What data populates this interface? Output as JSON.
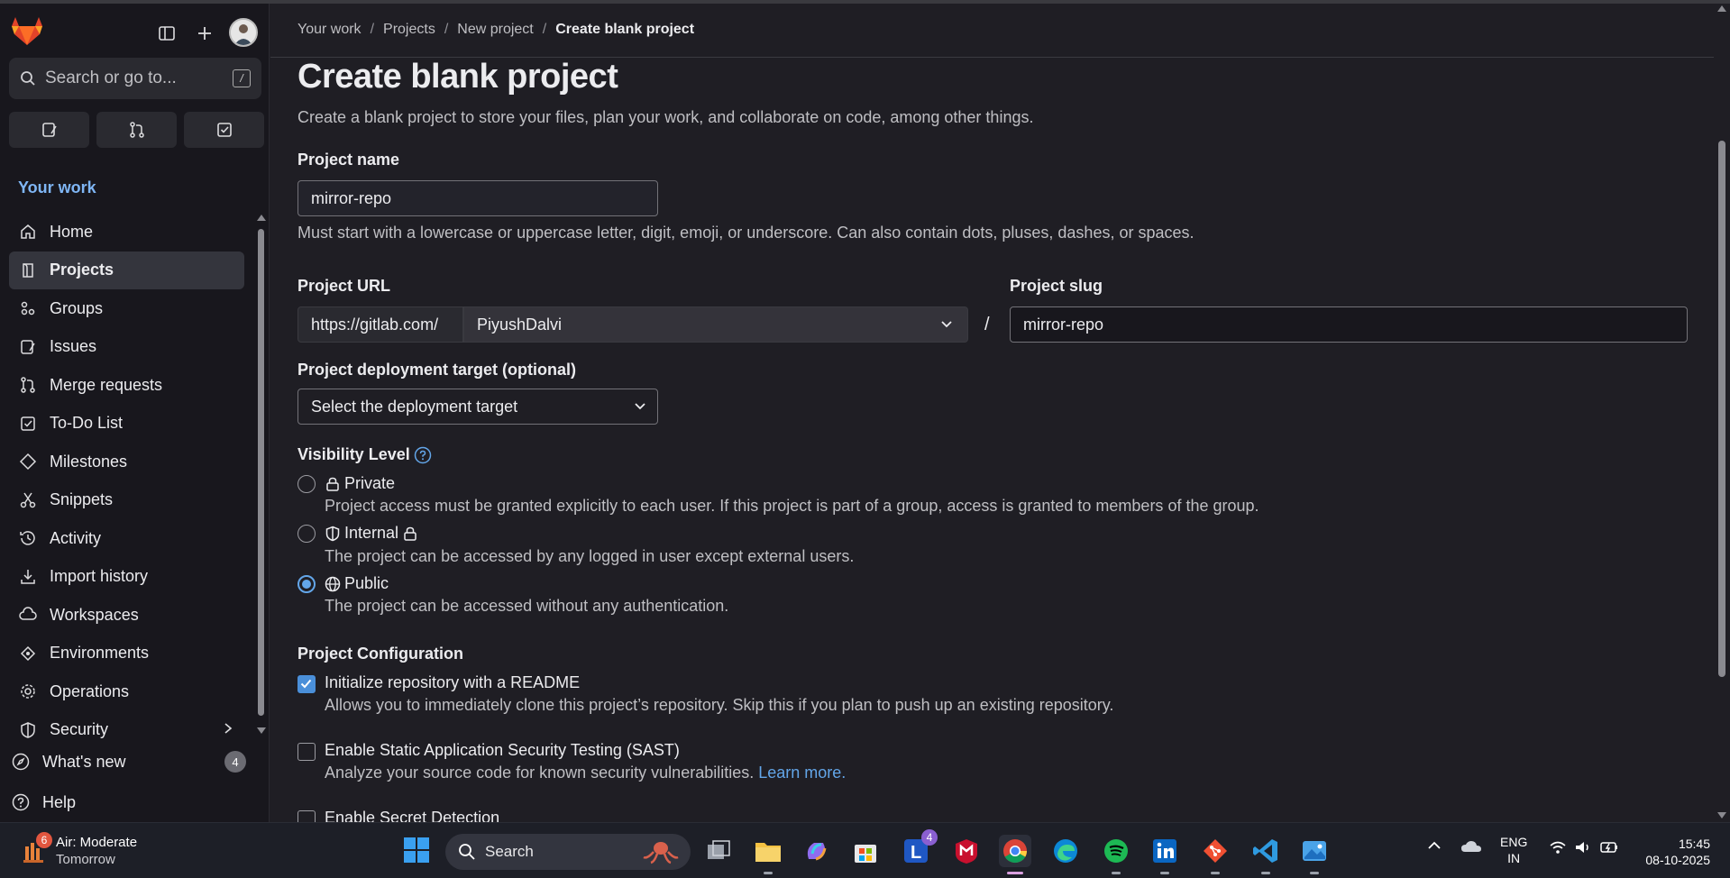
{
  "sidebar": {
    "search_placeholder": "Search or go to...",
    "search_shortcut": "/",
    "section_title": "Your work",
    "items": [
      {
        "label": "Home",
        "icon": "home-icon"
      },
      {
        "label": "Projects",
        "icon": "project-icon",
        "active": true
      },
      {
        "label": "Groups",
        "icon": "group-icon"
      },
      {
        "label": "Issues",
        "icon": "issues-icon"
      },
      {
        "label": "Merge requests",
        "icon": "merge-request-icon"
      },
      {
        "label": "To-Do List",
        "icon": "todo-icon"
      },
      {
        "label": "Milestones",
        "icon": "milestone-icon"
      },
      {
        "label": "Snippets",
        "icon": "snippet-icon"
      },
      {
        "label": "Activity",
        "icon": "history-icon"
      },
      {
        "label": "Import history",
        "icon": "download-icon"
      },
      {
        "label": "Workspaces",
        "icon": "workspace-icon"
      },
      {
        "label": "Environments",
        "icon": "environment-icon"
      },
      {
        "label": "Operations",
        "icon": "operations-icon"
      },
      {
        "label": "Security",
        "icon": "shield-icon"
      }
    ],
    "whats_new": {
      "label": "What's new",
      "count": "4"
    },
    "help_label": "Help"
  },
  "breadcrumb": [
    "Your work",
    "Projects",
    "New project",
    "Create blank project"
  ],
  "page": {
    "title": "Create blank project",
    "description": "Create a blank project to store your files, plan your work, and collaborate on code, among other things.",
    "project_name_label": "Project name",
    "project_name_value": "mirror-repo",
    "project_name_help": "Must start with a lowercase or uppercase letter, digit, emoji, or underscore. Can also contain dots, pluses, dashes, or spaces.",
    "project_url_label": "Project URL",
    "url_prefix": "https://gitlab.com/",
    "namespace": "PiyushDalvi",
    "slash": "/",
    "project_slug_label": "Project slug",
    "project_slug_value": "mirror-repo",
    "deployment_label": "Project deployment target (optional)",
    "deployment_value": "Select the deployment target",
    "visibility_label": "Visibility Level",
    "visibility": [
      {
        "label": "Private",
        "desc": "Project access must be granted explicitly to each user. If this project is part of a group, access is granted to members of the group.",
        "checked": false
      },
      {
        "label": "Internal",
        "desc": "The project can be accessed by any logged in user except external users.",
        "checked": false
      },
      {
        "label": "Public",
        "desc": "The project can be accessed without any authentication.",
        "checked": true
      }
    ],
    "config_label": "Project Configuration",
    "config": [
      {
        "label": "Initialize repository with a README",
        "desc": "Allows you to immediately clone this project’s repository. Skip this if you plan to push up an existing repository.",
        "checked": true
      },
      {
        "label": "Enable Static Application Security Testing (SAST)",
        "desc": "Analyze your source code for known security vulnerabilities.",
        "link": "Learn more.",
        "checked": false
      },
      {
        "label": "Enable Secret Detection",
        "checked": false
      }
    ]
  },
  "taskbar": {
    "weather_title": "Air: Moderate",
    "weather_sub": "Tomorrow",
    "weather_badge": "6",
    "search_label": "Search",
    "app_badge": "4",
    "lang_1": "ENG",
    "lang_2": "IN",
    "time": "15:45",
    "date": "08-10-2025"
  },
  "colors": {
    "accent": "#63a6e9",
    "sidebar_bg": "#18171d",
    "main_bg": "#1f1e24",
    "taskbar_bg": "#1d1f27"
  }
}
